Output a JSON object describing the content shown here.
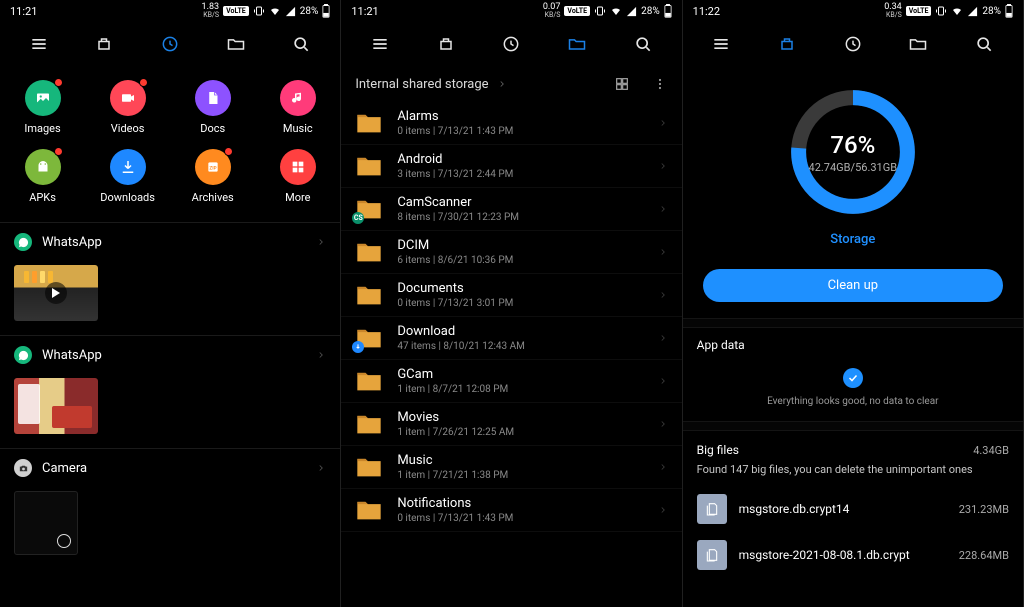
{
  "status": [
    {
      "time": "11:21",
      "kbs": "1.83",
      "unit": "KB/S",
      "net": "VoLTE",
      "battery": "28%"
    },
    {
      "time": "11:21",
      "kbs": "0.07",
      "unit": "KB/S",
      "net": "VoLTE",
      "battery": "28%"
    },
    {
      "time": "11:22",
      "kbs": "0.34",
      "unit": "KB/S",
      "net": "VoLTE",
      "battery": "28%"
    }
  ],
  "categories": [
    {
      "label": "Images",
      "color": "#16b77c",
      "dot": true
    },
    {
      "label": "Videos",
      "color": "#ff4757",
      "dot": true
    },
    {
      "label": "Docs",
      "color": "#8d52ff",
      "dot": false
    },
    {
      "label": "Music",
      "color": "#ff3b7a",
      "dot": false
    },
    {
      "label": "APKs",
      "color": "#7db83b",
      "dot": true
    },
    {
      "label": "Downloads",
      "color": "#1e88ff",
      "dot": false
    },
    {
      "label": "Archives",
      "color": "#ff8a1f",
      "dot": true
    },
    {
      "label": "More",
      "color": "#ff4040",
      "dot": false
    }
  ],
  "sources": [
    {
      "name": "WhatsApp",
      "icon_color": "#16b77c"
    },
    {
      "name": "WhatsApp",
      "icon_color": "#16b77c"
    },
    {
      "name": "Camera",
      "icon_color": "#d0d0d0"
    }
  ],
  "breadcrumb": "Internal shared storage",
  "folders": [
    {
      "name": "Alarms",
      "items": "0 items",
      "date": "7/13/21 1:43 PM",
      "badge": null
    },
    {
      "name": "Android",
      "items": "3 items",
      "date": "7/13/21 2:44 PM",
      "badge": null
    },
    {
      "name": "CamScanner",
      "items": "8 items",
      "date": "7/30/21 12:23 PM",
      "badge": "cs"
    },
    {
      "name": "DCIM",
      "items": "6 items",
      "date": "8/6/21 10:36 PM",
      "badge": null
    },
    {
      "name": "Documents",
      "items": "0 items",
      "date": "7/13/21 3:01 PM",
      "badge": null
    },
    {
      "name": "Download",
      "items": "47 items",
      "date": "8/10/21 12:43 AM",
      "badge": "dl"
    },
    {
      "name": "GCam",
      "items": "1 item",
      "date": "8/7/21 12:08 PM",
      "badge": null
    },
    {
      "name": "Movies",
      "items": "1 item",
      "date": "7/26/21 12:25 AM",
      "badge": null
    },
    {
      "name": "Music",
      "items": "1 item",
      "date": "7/21/21 1:38 PM",
      "badge": null
    },
    {
      "name": "Notifications",
      "items": "0 items",
      "date": "7/13/21 1:43 PM",
      "badge": null
    }
  ],
  "storage": {
    "percent": "76%",
    "deg": 274,
    "used": "42.74GB",
    "total": "56.31GB",
    "label": "Storage",
    "clean": "Clean up"
  },
  "appdata": {
    "title": "App data",
    "msg": "Everything looks good, no data to clear"
  },
  "bigfiles": {
    "title": "Big files",
    "size": "4.34GB",
    "desc": "Found 147 big files, you can delete the unimportant ones",
    "files": [
      {
        "name": "msgstore.db.crypt14",
        "size": "231.23MB"
      },
      {
        "name": "msgstore-2021-08-08.1.db.crypt",
        "size": "228.64MB"
      }
    ]
  }
}
